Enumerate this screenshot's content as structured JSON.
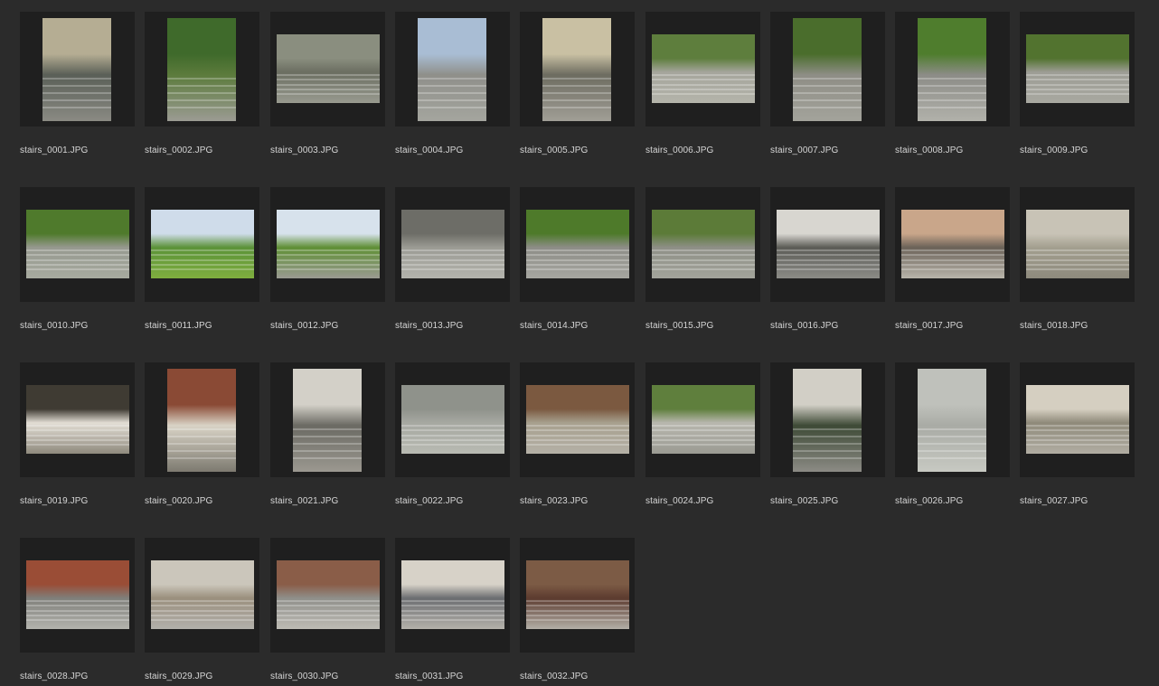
{
  "files": [
    {
      "name": "stairs_0001.JPG",
      "orientation": "portrait",
      "colors": [
        "#b5ad93",
        "#5a5f57",
        "#8a8a83"
      ]
    },
    {
      "name": "stairs_0002.JPG",
      "orientation": "portrait",
      "colors": [
        "#3f6a2b",
        "#5c7b3c",
        "#9b9b93"
      ]
    },
    {
      "name": "stairs_0003.JPG",
      "orientation": "landscape",
      "colors": [
        "#8a8e7f",
        "#6b6e61",
        "#989a8f"
      ]
    },
    {
      "name": "stairs_0004.JPG",
      "orientation": "portrait",
      "colors": [
        "#a9bdd4",
        "#8f8f8a",
        "#a4a59e"
      ]
    },
    {
      "name": "stairs_0005.JPG",
      "orientation": "portrait",
      "colors": [
        "#c9c0a3",
        "#6d6c60",
        "#a09e96"
      ]
    },
    {
      "name": "stairs_0006.JPG",
      "orientation": "landscape",
      "colors": [
        "#5e7e3d",
        "#a5a59c",
        "#b4b4aa"
      ]
    },
    {
      "name": "stairs_0007.JPG",
      "orientation": "portrait",
      "colors": [
        "#4a6d2c",
        "#8e8d85",
        "#a3a39b"
      ]
    },
    {
      "name": "stairs_0008.JPG",
      "orientation": "portrait",
      "colors": [
        "#4f7d2d",
        "#8c8c87",
        "#b1b1aa"
      ]
    },
    {
      "name": "stairs_0009.JPG",
      "orientation": "landscape",
      "colors": [
        "#52732f",
        "#9d9d95",
        "#a8a8a0"
      ]
    },
    {
      "name": "stairs_0010.JPG",
      "orientation": "landscape",
      "colors": [
        "#4f7a2c",
        "#96998f",
        "#a7aa9f"
      ]
    },
    {
      "name": "stairs_0011.JPG",
      "orientation": "landscape",
      "colors": [
        "#cfdcea",
        "#5b9238",
        "#7fae3f"
      ]
    },
    {
      "name": "stairs_0012.JPG",
      "orientation": "landscape",
      "colors": [
        "#d7e2ec",
        "#5f8f35",
        "#9a9a92"
      ]
    },
    {
      "name": "stairs_0013.JPG",
      "orientation": "landscape",
      "colors": [
        "#6d6d67",
        "#9b9b94",
        "#b3b3ac"
      ]
    },
    {
      "name": "stairs_0014.JPG",
      "orientation": "landscape",
      "colors": [
        "#4e7a2a",
        "#8d8d87",
        "#a6a6a0"
      ]
    },
    {
      "name": "stairs_0015.JPG",
      "orientation": "landscape",
      "colors": [
        "#5c7b38",
        "#8e8f86",
        "#a3a49b"
      ]
    },
    {
      "name": "stairs_0016.JPG",
      "orientation": "landscape",
      "colors": [
        "#d8d6d0",
        "#5b5b56",
        "#8b8b86"
      ]
    },
    {
      "name": "stairs_0017.JPG",
      "orientation": "landscape",
      "colors": [
        "#c9a68a",
        "#6b6258",
        "#b8b4aa"
      ]
    },
    {
      "name": "stairs_0018.JPG",
      "orientation": "landscape",
      "colors": [
        "#c8c3b6",
        "#a39f8f",
        "#8e8a7d"
      ]
    },
    {
      "name": "stairs_0019.JPG",
      "orientation": "landscape",
      "colors": [
        "#3f3b33",
        "#e2ddd4",
        "#8f8a7d"
      ]
    },
    {
      "name": "stairs_0020.JPG",
      "orientation": "portrait",
      "colors": [
        "#8a4a35",
        "#d9d3c6",
        "#7d7a70"
      ]
    },
    {
      "name": "stairs_0021.JPG",
      "orientation": "portrait",
      "colors": [
        "#d3d0c8",
        "#6b6a63",
        "#9b9890"
      ]
    },
    {
      "name": "stairs_0022.JPG",
      "orientation": "landscape",
      "colors": [
        "#8f928b",
        "#a6a8a1",
        "#b8bab2"
      ]
    },
    {
      "name": "stairs_0023.JPG",
      "orientation": "landscape",
      "colors": [
        "#7b5940",
        "#a7a08e",
        "#b4b0a6"
      ]
    },
    {
      "name": "stairs_0024.JPG",
      "orientation": "landscape",
      "colors": [
        "#5f7f3d",
        "#b8b7ae",
        "#9b9b93"
      ]
    },
    {
      "name": "stairs_0025.JPG",
      "orientation": "portrait",
      "colors": [
        "#d2cfc6",
        "#3e4a36",
        "#8c8b85"
      ]
    },
    {
      "name": "stairs_0026.JPG",
      "orientation": "portrait",
      "colors": [
        "#bfc1bb",
        "#a9aba5",
        "#c7c9c2"
      ]
    },
    {
      "name": "stairs_0027.JPG",
      "orientation": "landscape",
      "colors": [
        "#d5cfc1",
        "#8f8a7a",
        "#b0aca2"
      ]
    },
    {
      "name": "stairs_0028.JPG",
      "orientation": "landscape",
      "colors": [
        "#9a4d36",
        "#7f7f7a",
        "#b3b3ad"
      ]
    },
    {
      "name": "stairs_0029.JPG",
      "orientation": "landscape",
      "colors": [
        "#cbc6bb",
        "#9a8f7d",
        "#b2b0ab"
      ]
    },
    {
      "name": "stairs_0030.JPG",
      "orientation": "landscape",
      "colors": [
        "#8a5d48",
        "#8f8f8a",
        "#bdbbb4"
      ]
    },
    {
      "name": "stairs_0031.JPG",
      "orientation": "landscape",
      "colors": [
        "#d7d2c8",
        "#6b6d70",
        "#b4b1aa"
      ]
    },
    {
      "name": "stairs_0032.JPG",
      "orientation": "landscape",
      "colors": [
        "#7c5b45",
        "#5c3b2f",
        "#b3afa7"
      ]
    }
  ]
}
